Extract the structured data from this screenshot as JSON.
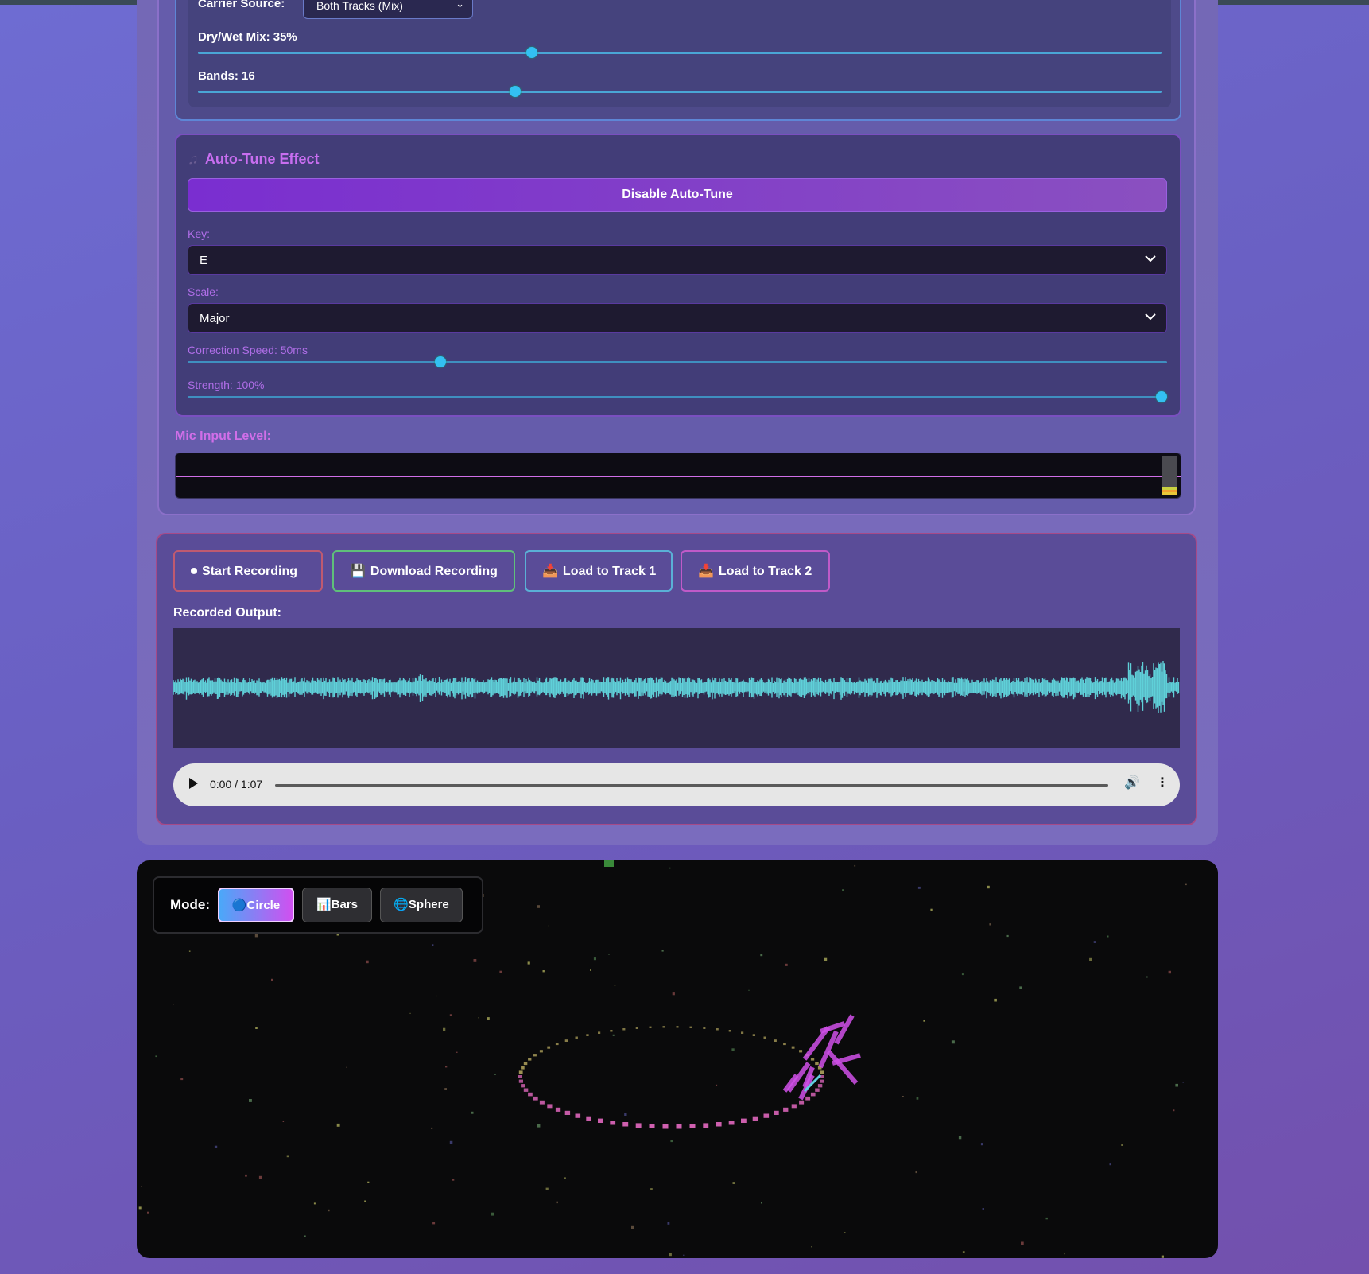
{
  "vocoder": {
    "carrier_label": "Carrier Source:",
    "carrier_value": "Both Tracks (Mix)",
    "drywet_label": "Dry/Wet Mix: 35%",
    "drywet_value": 35,
    "bands_label": "Bands: 16",
    "bands_value": 16
  },
  "autotune": {
    "icon": "music-note-icon",
    "title": "Auto-Tune Effect",
    "toggle_label": "Disable Auto-Tune",
    "key_label": "Key:",
    "key_value": "E",
    "scale_label": "Scale:",
    "scale_value": "Major",
    "correction_label": "Correction Speed: 50ms",
    "correction_fraction": 0.255,
    "strength_label": "Strength: 100%",
    "strength_fraction": 1.0
  },
  "mic": {
    "label": "Mic Input Level:",
    "line_color": "#d06ee8"
  },
  "recording": {
    "buttons": [
      {
        "icon": "record-icon",
        "label": "Start Recording",
        "border": "#c05a70"
      },
      {
        "icon": "floppy-disk-icon",
        "label": "Download Recording",
        "border": "#5fc07a"
      },
      {
        "icon": "inbox-tray-icon",
        "label": "Load to Track 1",
        "border": "#5ab0d6"
      },
      {
        "icon": "inbox-tray-icon",
        "label": "Load to Track 2",
        "border": "#c05ac8"
      }
    ],
    "output_label": "Recorded Output:",
    "waveform_color": "#5fd0d8",
    "player": {
      "time": "0:00 / 1:07"
    }
  },
  "visualizer": {
    "mode_label": "Mode:",
    "modes": [
      {
        "icon": "blue-circle-icon",
        "label": "Circle",
        "active": true
      },
      {
        "icon": "bar-chart-icon",
        "label": "Bars",
        "active": false
      },
      {
        "icon": "globe-icon",
        "label": "Sphere",
        "active": false
      }
    ]
  },
  "colors": {
    "accent_purple": "#c86ef0",
    "slider_thumb": "#33c0f2",
    "active_mode_gradient": [
      "#4aa8f8",
      "#d050f0"
    ]
  }
}
